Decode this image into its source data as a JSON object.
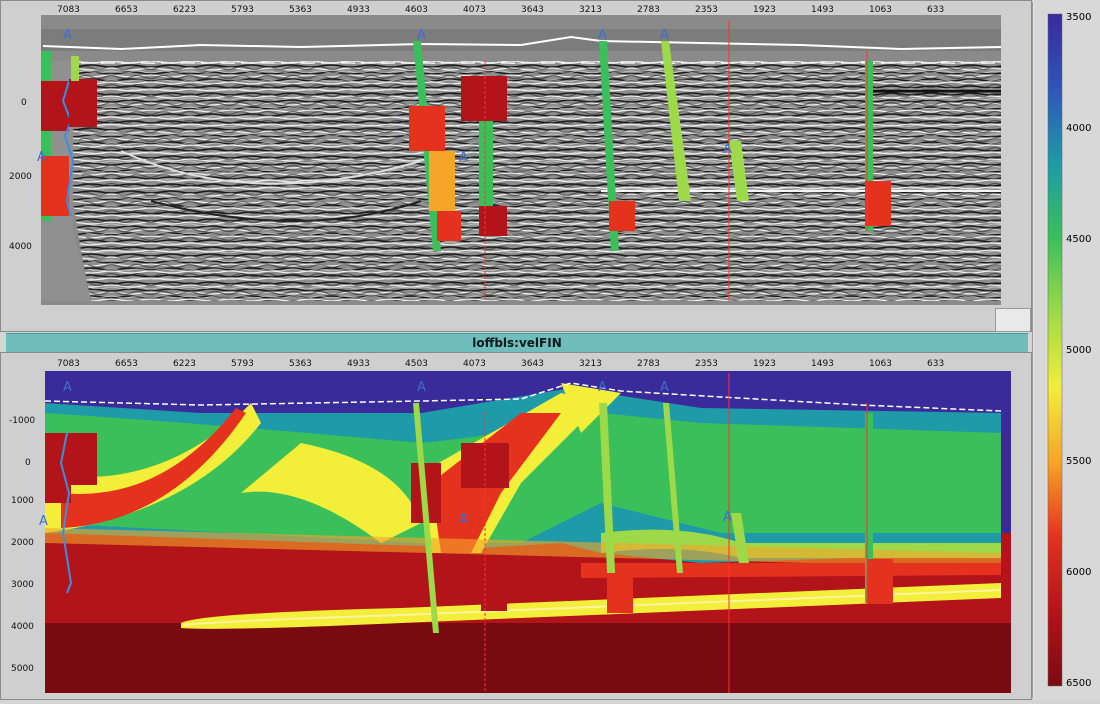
{
  "top_panel": {
    "x_ticks": [
      "7083",
      "6653",
      "6223",
      "5793",
      "5363",
      "4933",
      "4603",
      "4073",
      "3643",
      "3213",
      "2783",
      "2353",
      "1923",
      "1493",
      "1063",
      "633"
    ],
    "y_ticks": [
      "0",
      "2000",
      "4000"
    ]
  },
  "velocity_panel": {
    "title": "loffbls:velFIN",
    "x_ticks": [
      "7083",
      "6653",
      "6223",
      "5793",
      "5363",
      "4933",
      "4503",
      "4073",
      "3643",
      "3213",
      "2783",
      "2353",
      "1923",
      "1493",
      "1063",
      "633"
    ],
    "y_ticks": [
      "-1000",
      "0",
      "1000",
      "2000",
      "3000",
      "4000",
      "5000"
    ]
  },
  "colorbar": {
    "labels": [
      "3500",
      "4000",
      "4500",
      "5000",
      "5500",
      "6000",
      "6500"
    ],
    "colors": [
      "#3a2a9a",
      "#2f55b8",
      "#1f9aa8",
      "#3bbf5a",
      "#9ed94a",
      "#f2ee3a",
      "#f5a52a",
      "#e4321e",
      "#b3141a",
      "#7a0a12"
    ]
  },
  "well_marker": "A"
}
